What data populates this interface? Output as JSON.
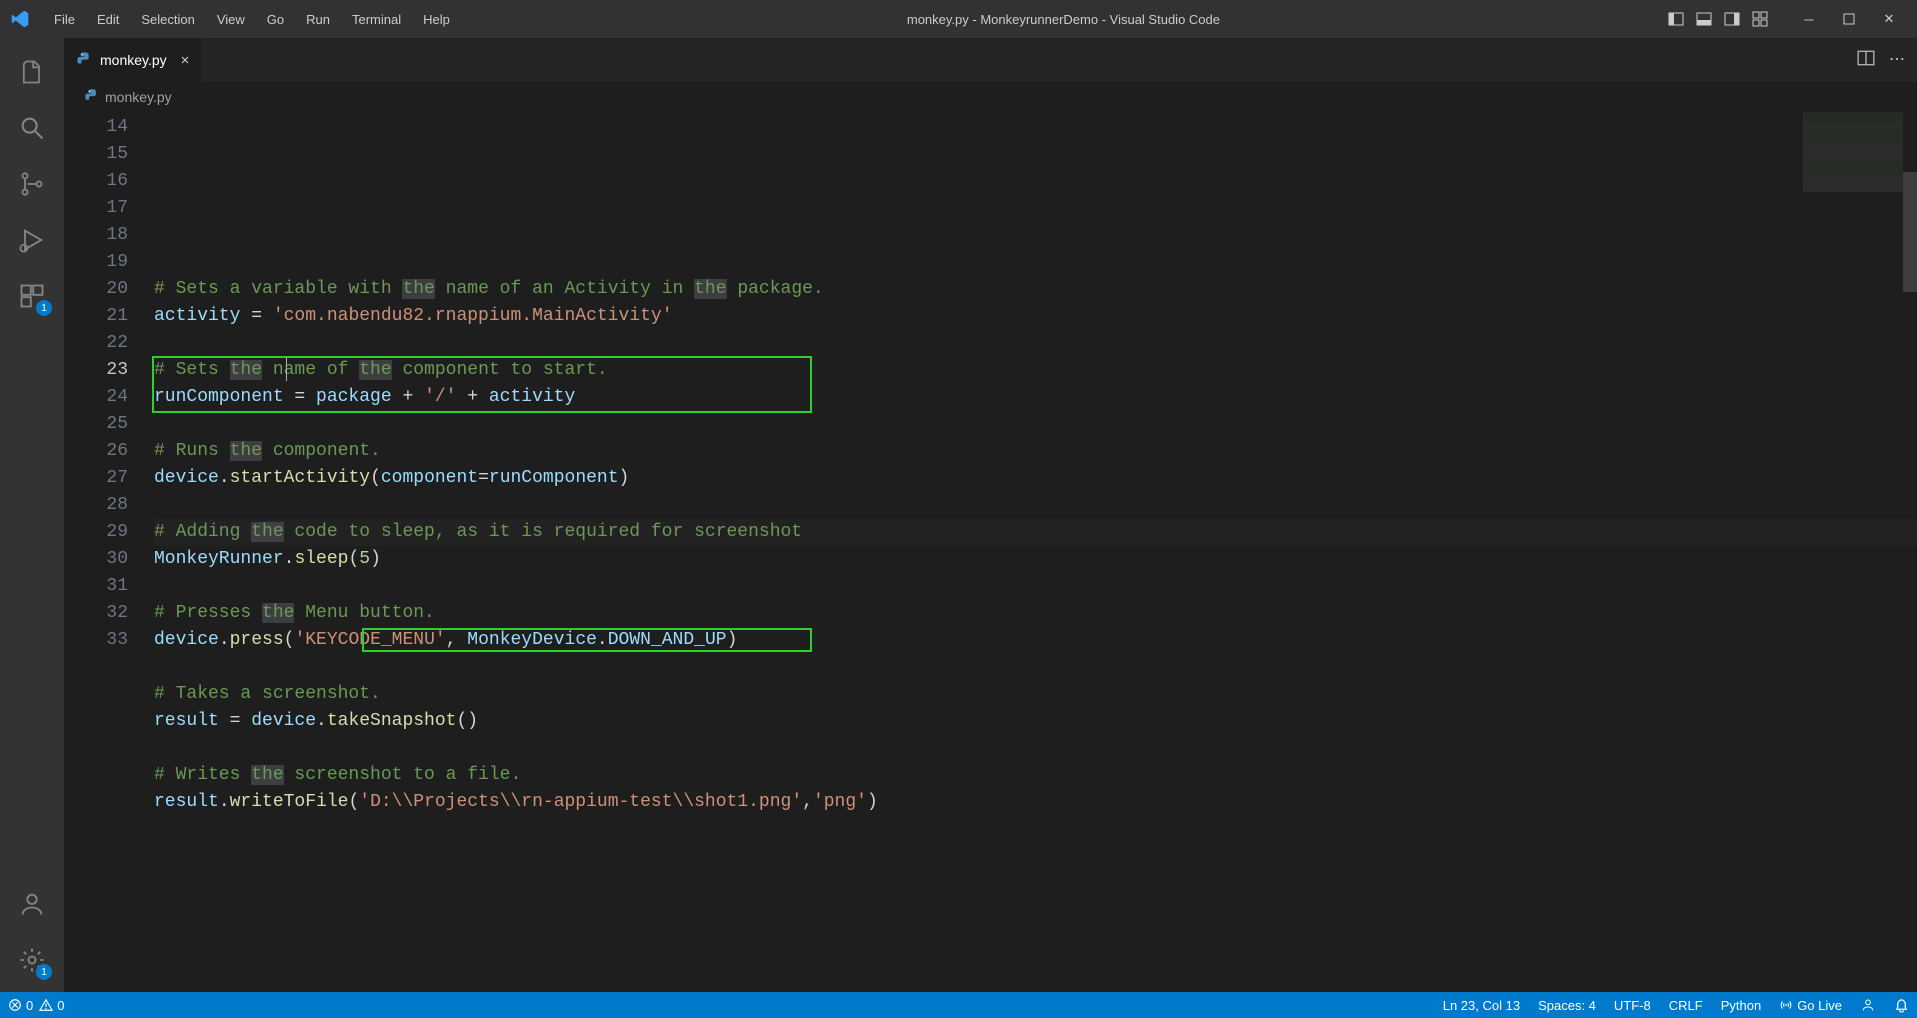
{
  "titlebar": {
    "title": "monkey.py - MonkeyrunnerDemo - Visual Studio Code",
    "menu": [
      "File",
      "Edit",
      "Selection",
      "View",
      "Go",
      "Run",
      "Terminal",
      "Help"
    ]
  },
  "tab": {
    "filename": "monkey.py"
  },
  "breadcrumb": {
    "filename": "monkey.py"
  },
  "activity": {
    "extensions_badge": "1",
    "settings_badge": "1"
  },
  "editor": {
    "first_line_no": 14,
    "active_line_no": 23,
    "lines": [
      {
        "n": 14,
        "tokens": [
          {
            "c": "tok-comment",
            "t": "# Sets a variable with "
          },
          {
            "c": "tok-comment hl-the",
            "t": "the"
          },
          {
            "c": "tok-comment",
            "t": " name of an Activity in "
          },
          {
            "c": "tok-comment hl-the",
            "t": "the"
          },
          {
            "c": "tok-comment",
            "t": " package."
          }
        ]
      },
      {
        "n": 15,
        "tokens": [
          {
            "c": "tok-var",
            "t": "activity"
          },
          {
            "c": "tok-default",
            "t": " = "
          },
          {
            "c": "tok-string",
            "t": "'com.nabendu82.rnappium.MainActivity'"
          }
        ]
      },
      {
        "n": 16,
        "tokens": []
      },
      {
        "n": 17,
        "tokens": [
          {
            "c": "tok-comment",
            "t": "# Sets "
          },
          {
            "c": "tok-comment hl-the",
            "t": "the"
          },
          {
            "c": "tok-comment",
            "t": " name of "
          },
          {
            "c": "tok-comment hl-the",
            "t": "the"
          },
          {
            "c": "tok-comment",
            "t": " component to start."
          }
        ]
      },
      {
        "n": 18,
        "tokens": [
          {
            "c": "tok-var",
            "t": "runComponent"
          },
          {
            "c": "tok-default",
            "t": " = "
          },
          {
            "c": "tok-var",
            "t": "package"
          },
          {
            "c": "tok-default",
            "t": " + "
          },
          {
            "c": "tok-string",
            "t": "'/'"
          },
          {
            "c": "tok-default",
            "t": " + "
          },
          {
            "c": "tok-var",
            "t": "activity"
          }
        ]
      },
      {
        "n": 19,
        "tokens": []
      },
      {
        "n": 20,
        "tokens": [
          {
            "c": "tok-comment",
            "t": "# Runs "
          },
          {
            "c": "tok-comment hl-the",
            "t": "the"
          },
          {
            "c": "tok-comment",
            "t": " component."
          }
        ]
      },
      {
        "n": 21,
        "tokens": [
          {
            "c": "tok-var",
            "t": "device"
          },
          {
            "c": "tok-default",
            "t": "."
          },
          {
            "c": "tok-func",
            "t": "startActivity"
          },
          {
            "c": "tok-punct",
            "t": "("
          },
          {
            "c": "tok-param",
            "t": "component"
          },
          {
            "c": "tok-default",
            "t": "="
          },
          {
            "c": "tok-var",
            "t": "runComponent"
          },
          {
            "c": "tok-punct",
            "t": ")"
          }
        ]
      },
      {
        "n": 22,
        "tokens": []
      },
      {
        "n": 23,
        "tokens": [
          {
            "c": "tok-comment",
            "t": "# Adding "
          },
          {
            "c": "tok-comment hl-the",
            "t": "the"
          },
          {
            "c": "tok-comment",
            "t": " code to sleep, as it is required for screenshot"
          }
        ]
      },
      {
        "n": 24,
        "tokens": [
          {
            "c": "tok-var",
            "t": "MonkeyRunner"
          },
          {
            "c": "tok-default",
            "t": "."
          },
          {
            "c": "tok-func",
            "t": "sleep"
          },
          {
            "c": "tok-punct",
            "t": "("
          },
          {
            "c": "tok-number",
            "t": "5"
          },
          {
            "c": "tok-punct",
            "t": ")"
          }
        ]
      },
      {
        "n": 25,
        "tokens": []
      },
      {
        "n": 26,
        "tokens": [
          {
            "c": "tok-comment",
            "t": "# Presses "
          },
          {
            "c": "tok-comment hl-the",
            "t": "the"
          },
          {
            "c": "tok-comment",
            "t": " Menu button."
          }
        ]
      },
      {
        "n": 27,
        "tokens": [
          {
            "c": "tok-var",
            "t": "device"
          },
          {
            "c": "tok-default",
            "t": "."
          },
          {
            "c": "tok-func",
            "t": "press"
          },
          {
            "c": "tok-punct",
            "t": "("
          },
          {
            "c": "tok-string",
            "t": "'KEYCODE_MENU'"
          },
          {
            "c": "tok-default",
            "t": ", "
          },
          {
            "c": "tok-var",
            "t": "MonkeyDevice"
          },
          {
            "c": "tok-default",
            "t": "."
          },
          {
            "c": "tok-var",
            "t": "DOWN_AND_UP"
          },
          {
            "c": "tok-punct",
            "t": ")"
          }
        ]
      },
      {
        "n": 28,
        "tokens": []
      },
      {
        "n": 29,
        "tokens": [
          {
            "c": "tok-comment",
            "t": "# Takes a screenshot."
          }
        ]
      },
      {
        "n": 30,
        "tokens": [
          {
            "c": "tok-var",
            "t": "result"
          },
          {
            "c": "tok-default",
            "t": " = "
          },
          {
            "c": "tok-var",
            "t": "device"
          },
          {
            "c": "tok-default",
            "t": "."
          },
          {
            "c": "tok-func",
            "t": "takeSnapshot"
          },
          {
            "c": "tok-punct",
            "t": "()"
          }
        ]
      },
      {
        "n": 31,
        "tokens": []
      },
      {
        "n": 32,
        "tokens": [
          {
            "c": "tok-comment",
            "t": "# Writes "
          },
          {
            "c": "tok-comment hl-the",
            "t": "the"
          },
          {
            "c": "tok-comment",
            "t": " screenshot to a file."
          }
        ]
      },
      {
        "n": 33,
        "tokens": [
          {
            "c": "tok-var",
            "t": "result"
          },
          {
            "c": "tok-default",
            "t": "."
          },
          {
            "c": "tok-func",
            "t": "writeToFile"
          },
          {
            "c": "tok-punct",
            "t": "("
          },
          {
            "c": "tok-string",
            "t": "'D:\\\\Projects\\\\rn-appium-test\\\\shot1.png'"
          },
          {
            "c": "tok-default",
            "t": ","
          },
          {
            "c": "tok-string",
            "t": "'png'"
          },
          {
            "c": "tok-punct",
            "t": ")"
          }
        ]
      }
    ]
  },
  "statusbar": {
    "errors": "0",
    "warnings": "0",
    "position": "Ln 23, Col 13",
    "spaces": "Spaces: 4",
    "encoding": "UTF-8",
    "eol": "CRLF",
    "lang": "Python",
    "golive": "Go Live"
  }
}
